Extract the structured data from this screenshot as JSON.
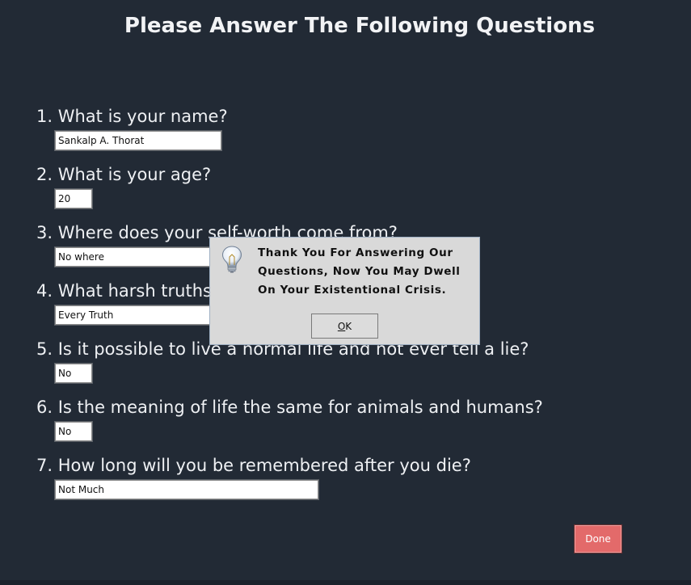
{
  "title": "Please Answer The Following Questions",
  "questions": [
    {
      "label": "1. What is your name?",
      "answer": "Sankalp A. Thorat"
    },
    {
      "label": "2. What is your age?",
      "answer": "20"
    },
    {
      "label": "3. Where does your self-worth come from?",
      "answer": "No where"
    },
    {
      "label": "4. What harsh truths do you prefer to ignore?",
      "answer": "Every Truth"
    },
    {
      "label": "5. Is it possible to live a normal life and not ever tell a lie?",
      "answer": "No"
    },
    {
      "label": "6. Is the meaning of life the same for animals and humans?",
      "answer": "No"
    },
    {
      "label": "7. How long will you be remembered after you die?",
      "answer": "Not Much"
    }
  ],
  "done_label": "Done",
  "dialog": {
    "icon": "lightbulb-icon",
    "message": "Thank You For Answering Our Questions, Now You May Dwell On Your Existentional Crisis.",
    "ok_mnemonic": "O",
    "ok_rest": "K"
  },
  "colors": {
    "background": "#222a35",
    "done_button": "#e36a6a",
    "dialog_background": "#d9d9d9"
  }
}
